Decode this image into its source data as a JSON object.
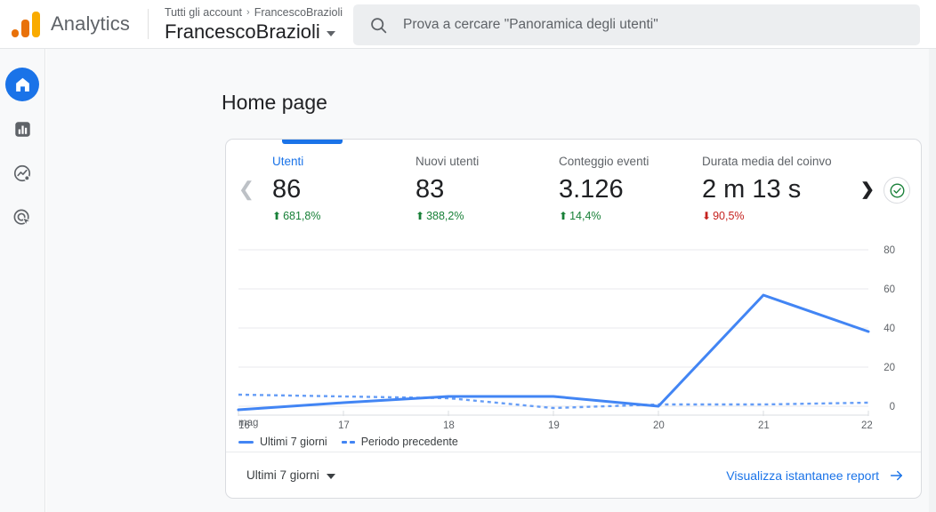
{
  "header": {
    "logo_icon": "analytics-logo-icon",
    "brand": "Analytics",
    "breadcrumb_root": "Tutti gli account",
    "breadcrumb_sep": "›",
    "breadcrumb_current": "FrancescoBrazioli",
    "account_name": "FrancescoBrazioli",
    "account_caret_icon": "caret-down-icon"
  },
  "search": {
    "icon": "search-icon",
    "placeholder": "Prova a cercare \"Panoramica degli utenti\"",
    "value": ""
  },
  "sidebar": {
    "items": [
      {
        "name": "home",
        "icon": "home-icon",
        "active": true
      },
      {
        "name": "reports",
        "icon": "bar-chart-icon",
        "active": false
      },
      {
        "name": "explore",
        "icon": "explore-trending-icon",
        "active": false
      },
      {
        "name": "advertising",
        "icon": "advertising-target-icon",
        "active": false
      }
    ]
  },
  "main": {
    "page_title": "Home page"
  },
  "card": {
    "prev_chevron_icon": "chevron-left-icon",
    "next_chevron_icon": "chevron-right-icon",
    "status_icon": "check-circle-icon",
    "status_color": "#188038",
    "accent_color": "#1a73e8",
    "metrics": [
      {
        "label": "Utenti",
        "value": "86",
        "delta": "681,8%",
        "direction": "up",
        "selected": true
      },
      {
        "label": "Nuovi utenti",
        "value": "83",
        "delta": "388,2%",
        "direction": "up",
        "selected": false
      },
      {
        "label": "Conteggio eventi",
        "value": "3.126",
        "delta": "14,4%",
        "direction": "up",
        "selected": false
      },
      {
        "label": "Durata media del coinvo",
        "value": "2 m 13 s",
        "delta": "90,5%",
        "direction": "down",
        "selected": false
      }
    ],
    "legend": [
      {
        "label": "Ultimi 7 giorni",
        "style": "solid",
        "color": "#4285f4"
      },
      {
        "label": "Periodo precedente",
        "style": "dashed",
        "color": "#669df6"
      }
    ],
    "footer": {
      "range_label": "Ultimi 7 giorni",
      "range_caret_icon": "caret-down-icon",
      "report_link": "Visualizza istantanee report",
      "report_link_icon": "arrow-right-icon"
    }
  },
  "chart_data": {
    "type": "line",
    "title": "",
    "xlabel": "",
    "ylabel": "",
    "x_tick_labels": [
      "16",
      "17",
      "18",
      "19",
      "20",
      "21",
      "22"
    ],
    "x_axis_unit": "mag",
    "y_tick_labels": [
      "0",
      "20",
      "40",
      "60",
      "80"
    ],
    "ylim": [
      -4,
      80
    ],
    "y_ticks": [
      0,
      20,
      40,
      60,
      80
    ],
    "grid": true,
    "legend_position": "bottom-left",
    "series": [
      {
        "name": "Ultimi 7 giorni",
        "style": "solid",
        "color": "#4285f4",
        "values": [
          -2,
          2,
          5,
          5,
          0,
          57,
          38
        ]
      },
      {
        "name": "Periodo precedente",
        "style": "dashed",
        "color": "#669df6",
        "values": [
          6,
          5,
          4,
          -1,
          1,
          1,
          2
        ]
      }
    ]
  }
}
